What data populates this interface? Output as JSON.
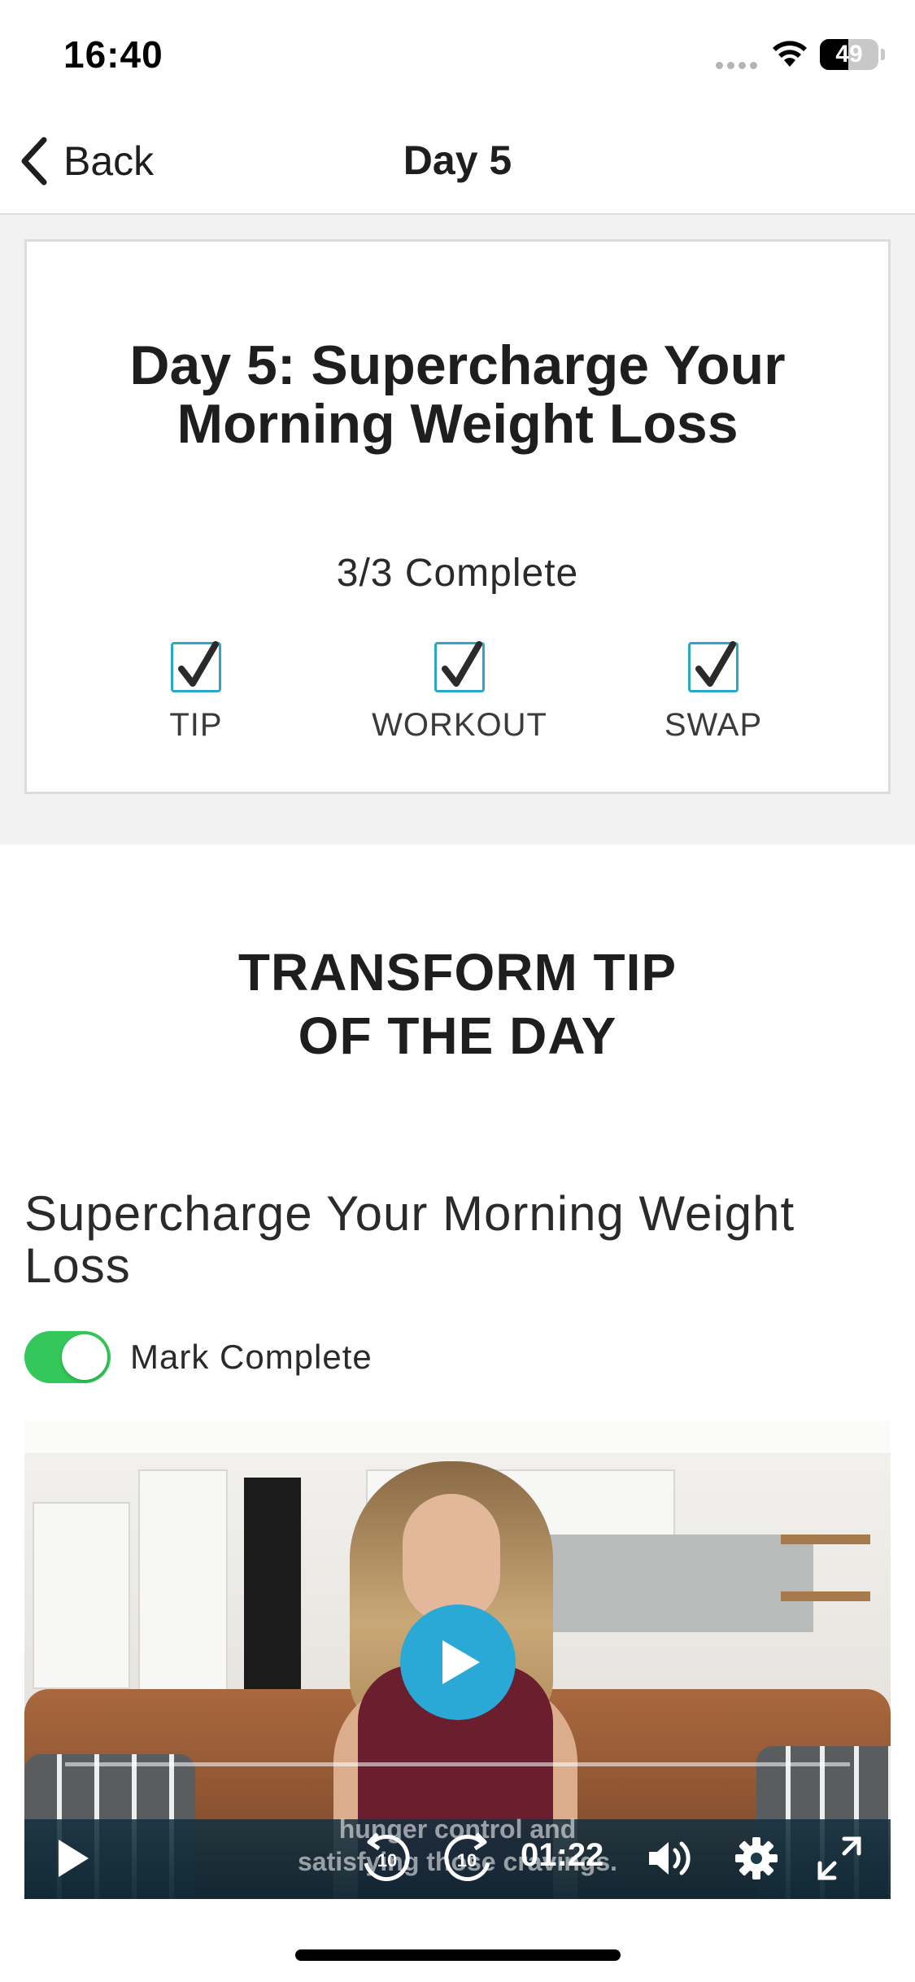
{
  "status_bar": {
    "time": "16:40",
    "battery_percent": "49",
    "battery_level": 0.49
  },
  "nav": {
    "back_label": "Back",
    "title": "Day 5"
  },
  "progress_card": {
    "title": "Day 5: Supercharge Your Morning Weight Loss",
    "complete_text": "3/3 Complete",
    "tasks": [
      {
        "label": "TIP",
        "checked": true
      },
      {
        "label": "WORKOUT",
        "checked": true
      },
      {
        "label": "SWAP",
        "checked": true
      }
    ]
  },
  "tip_section": {
    "heading_line1": "TRANSFORM TIP",
    "heading_line2": "OF THE DAY",
    "subtitle": "Supercharge Your Morning Weight Loss",
    "mark_complete_label": "Mark Complete",
    "mark_complete_on": true
  },
  "video": {
    "caption_line1": "hunger control and",
    "caption_line2": "satisfying those cravings.",
    "time": "01:22",
    "skip_back_label": "10",
    "skip_forward_label": "10",
    "accent_color": "#2aa8d6"
  },
  "colors": {
    "toggle_on": "#34c759",
    "checkbox_border": "#2aa8c6",
    "section_bg": "#f2f2f2"
  }
}
